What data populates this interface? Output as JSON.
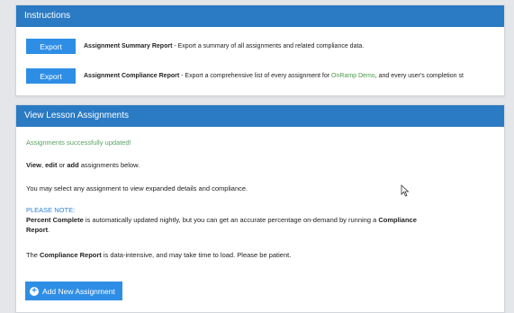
{
  "instructions": {
    "title": "Instructions",
    "rows": [
      {
        "button": "Export",
        "name": "Assignment Summary Report",
        "desc": " - Export a summary of all assignments and related compliance data."
      },
      {
        "button": "Export",
        "name": "Assignment Compliance Report",
        "desc_before": " - Export a comprehensive list of every assignment for ",
        "link": "OnRamp Demo",
        "desc_after": ", and every user's completion st"
      }
    ]
  },
  "assignments": {
    "title": "View Lesson Assignments",
    "success": "Assignments successfully updated!",
    "line1": {
      "view": "View",
      "sep1": ", ",
      "edit": "edit",
      "sep2": " or ",
      "add": "add",
      "rest": " assignments below."
    },
    "line2": "You may select any assignment to view expanded details and compliance.",
    "note_title": "PLEASE NOTE:",
    "note": {
      "bold1": "Percent Complete",
      "text1": " is automatically updated nightly, but you can get an accurate percentage on-demand by running a ",
      "bold2": "Compliance Report",
      "text2": "."
    },
    "line3": {
      "pre": "The ",
      "bold": "Compliance Report",
      "post": " is data-intensive, and may take time to load. Please be patient."
    },
    "add_button": "Add New Assignment"
  }
}
